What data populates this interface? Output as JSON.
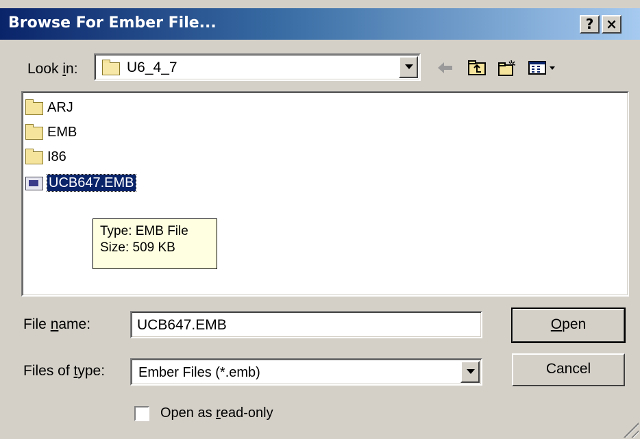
{
  "window": {
    "title": "Browse For Ember File...",
    "help_button": "?",
    "close_button": "×"
  },
  "toolbar": {
    "look_in_prefix": "Look ",
    "look_in_accel": "i",
    "look_in_suffix": "n:",
    "current_folder": "U6_4_7",
    "icons": [
      "back-arrow-icon",
      "up-one-level-icon",
      "new-folder-icon",
      "view-menu-icon"
    ]
  },
  "file_list": {
    "items": [
      {
        "name": "ARJ",
        "kind": "folder"
      },
      {
        "name": "EMB",
        "kind": "folder"
      },
      {
        "name": "I86",
        "kind": "folder"
      },
      {
        "name": "UCB647.EMB",
        "kind": "file",
        "selected": true
      }
    ],
    "tooltip": {
      "type_line": "Type: EMB File",
      "size_line": "Size: 509 KB"
    }
  },
  "form": {
    "file_name_prefix": "File ",
    "file_name_accel": "n",
    "file_name_suffix": "ame:",
    "file_name_value": "UCB647.EMB",
    "files_of_type_prefix": "Files of ",
    "files_of_type_accel": "t",
    "files_of_type_suffix": "ype:",
    "files_of_type_value": "Ember Files (*.emb)",
    "read_only_prefix": "Open as ",
    "read_only_accel": "r",
    "read_only_suffix": "ead-only",
    "read_only_checked": false
  },
  "buttons": {
    "open_accel": "O",
    "open_rest": "pen",
    "cancel": "Cancel"
  },
  "colors": {
    "title_start": "#0a246a",
    "title_end": "#a6caf0",
    "face": "#d4d0c8",
    "selection": "#0a246a",
    "tooltip_bg": "#ffffe1"
  }
}
